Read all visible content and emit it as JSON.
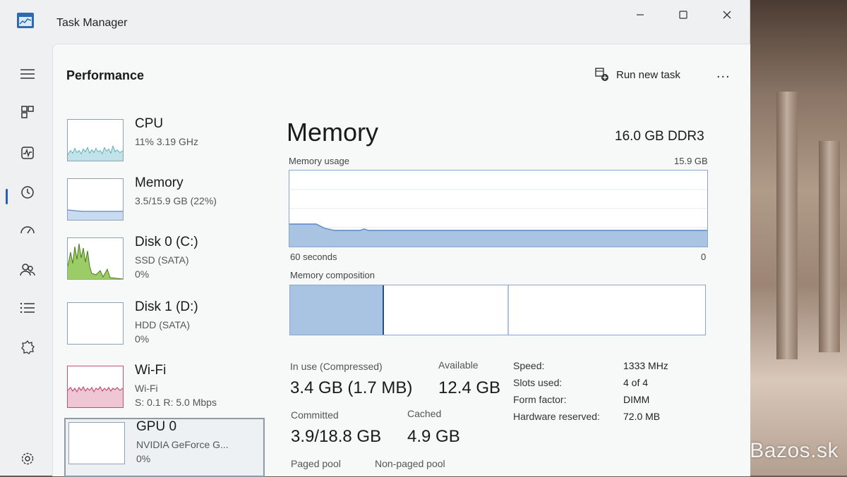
{
  "window": {
    "title": "Task Manager"
  },
  "header": {
    "title": "Performance",
    "run_new_task": "Run new task",
    "more": "..."
  },
  "sidebar": {
    "items": [
      {
        "icon": "hamburger-menu-icon"
      },
      {
        "icon": "processes-icon"
      },
      {
        "icon": "performance-icon"
      },
      {
        "icon": "app-history-icon"
      },
      {
        "icon": "startup-apps-icon"
      },
      {
        "icon": "users-icon"
      },
      {
        "icon": "details-icon"
      },
      {
        "icon": "services-icon"
      },
      {
        "icon": "settings-icon"
      }
    ]
  },
  "perf_list": [
    {
      "name": "CPU",
      "line1": "11%  3.19 GHz",
      "line2": ""
    },
    {
      "name": "Memory",
      "line1": "3.5/15.9 GB (22%)",
      "line2": ""
    },
    {
      "name": "Disk 0 (C:)",
      "line1": "SSD (SATA)",
      "line2": "0%"
    },
    {
      "name": "Disk 1 (D:)",
      "line1": "HDD (SATA)",
      "line2": "0%"
    },
    {
      "name": "Wi-Fi",
      "line1": "Wi-Fi",
      "line2": "S: 0.1  R: 5.0 Mbps"
    },
    {
      "name": "GPU 0",
      "line1": "NVIDIA GeForce G...",
      "line2": "0%"
    }
  ],
  "memory": {
    "title": "Memory",
    "total": "16.0 GB DDR3",
    "usage_label": "Memory usage",
    "usage_max": "15.9 GB",
    "time_left": "60 seconds",
    "time_right": "0",
    "composition_label": "Memory composition",
    "in_use_label": "In use (Compressed)",
    "in_use_value": "3.4 GB (1.7 MB)",
    "available_label": "Available",
    "available_value": "12.4 GB",
    "committed_label": "Committed",
    "committed_value": "3.9/18.8 GB",
    "cached_label": "Cached",
    "cached_value": "4.9 GB",
    "paged_label": "Paged pool",
    "nonpaged_label": "Non-paged pool",
    "specs": [
      {
        "key": "Speed:",
        "value": "1333 MHz"
      },
      {
        "key": "Slots used:",
        "value": "4 of 4"
      },
      {
        "key": "Form factor:",
        "value": "DIMM"
      },
      {
        "key": "Hardware reserved:",
        "value": "72.0 MB"
      }
    ]
  },
  "watermark": "@Bazos.sk",
  "colors": {
    "memory_fill": "#a9c3e3",
    "memory_line": "#5b87c2",
    "disk_fill": "#9ccc65",
    "wifi_line": "#c0507a",
    "accent": "#2b5fb0"
  }
}
